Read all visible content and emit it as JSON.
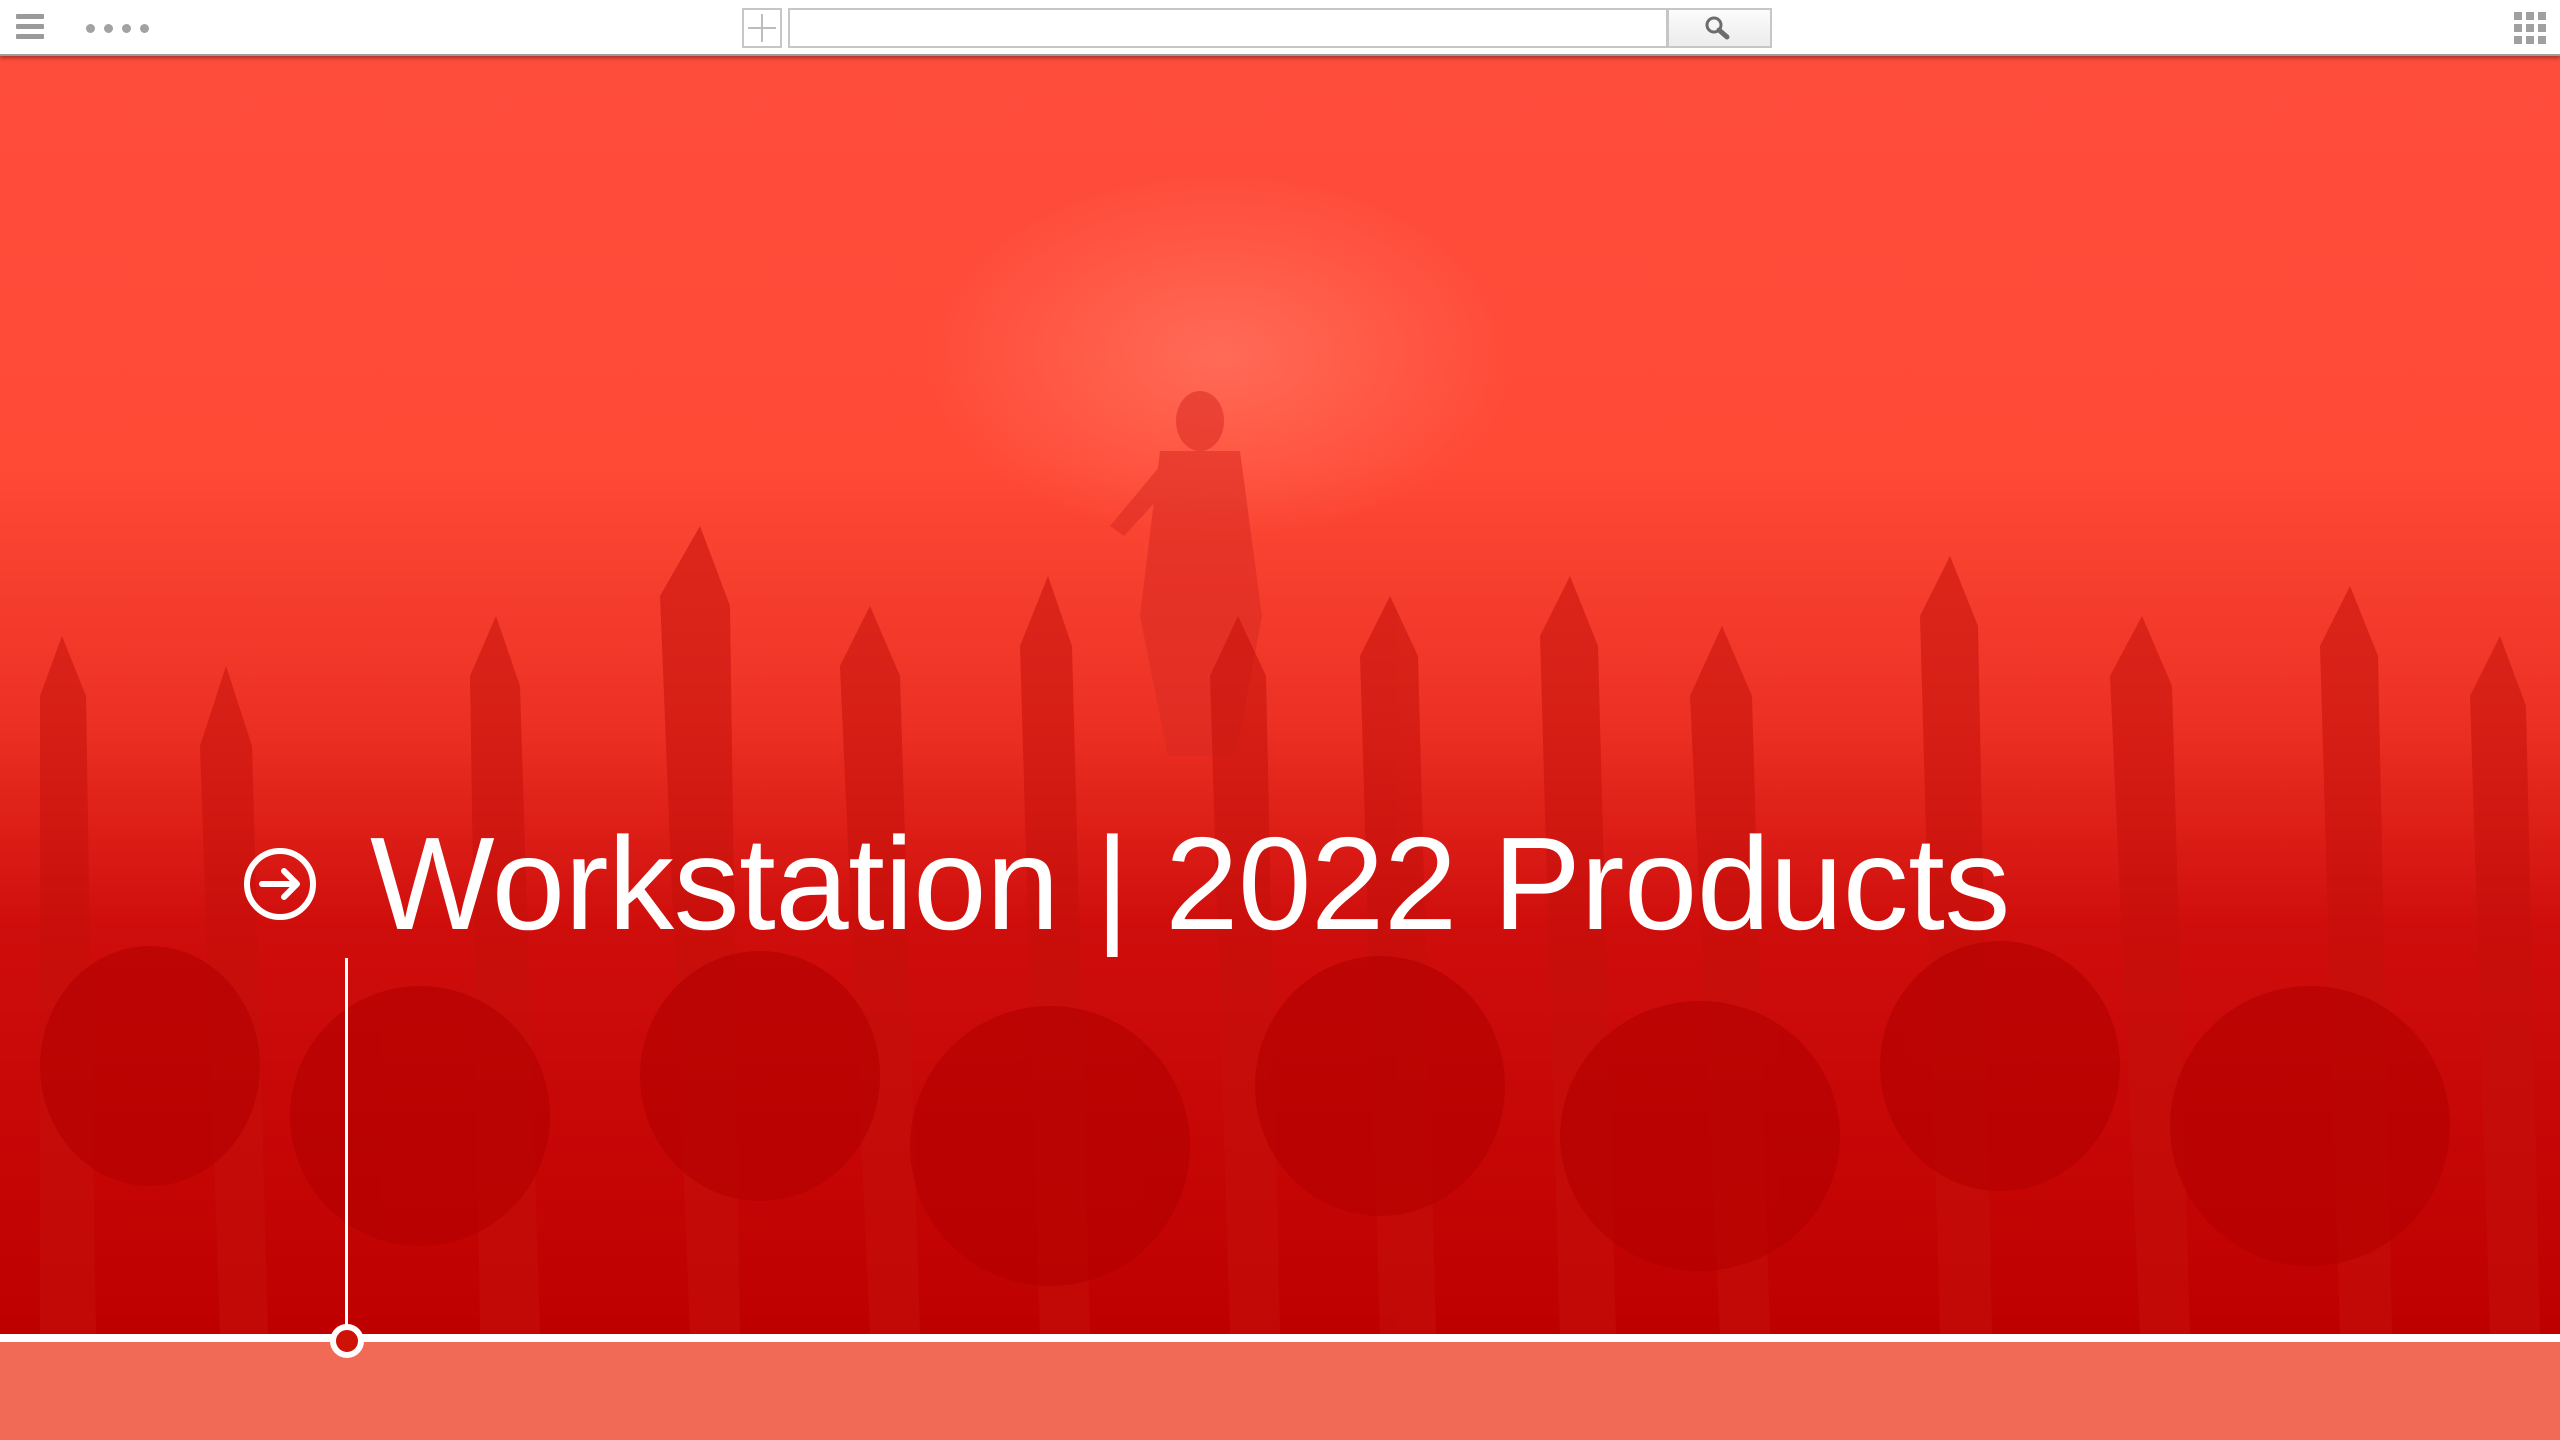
{
  "toolbar": {
    "menu_icon": "hamburger-menu-icon",
    "more_icon": "dots-icon",
    "add_icon": "plus-icon",
    "search": {
      "value": "",
      "placeholder": "",
      "icon": "magnifier-icon"
    },
    "apps_icon": "grid-apps-icon"
  },
  "hero": {
    "title": "Workstation | 2022 Products",
    "icon": "circled-arrow-right-icon",
    "background_image": "concert-crowd-photo",
    "overlay_color": "#e8261c"
  },
  "timeline": {
    "marker_icon": "timeline-marker-circle",
    "strip_color": "#f06a55"
  }
}
